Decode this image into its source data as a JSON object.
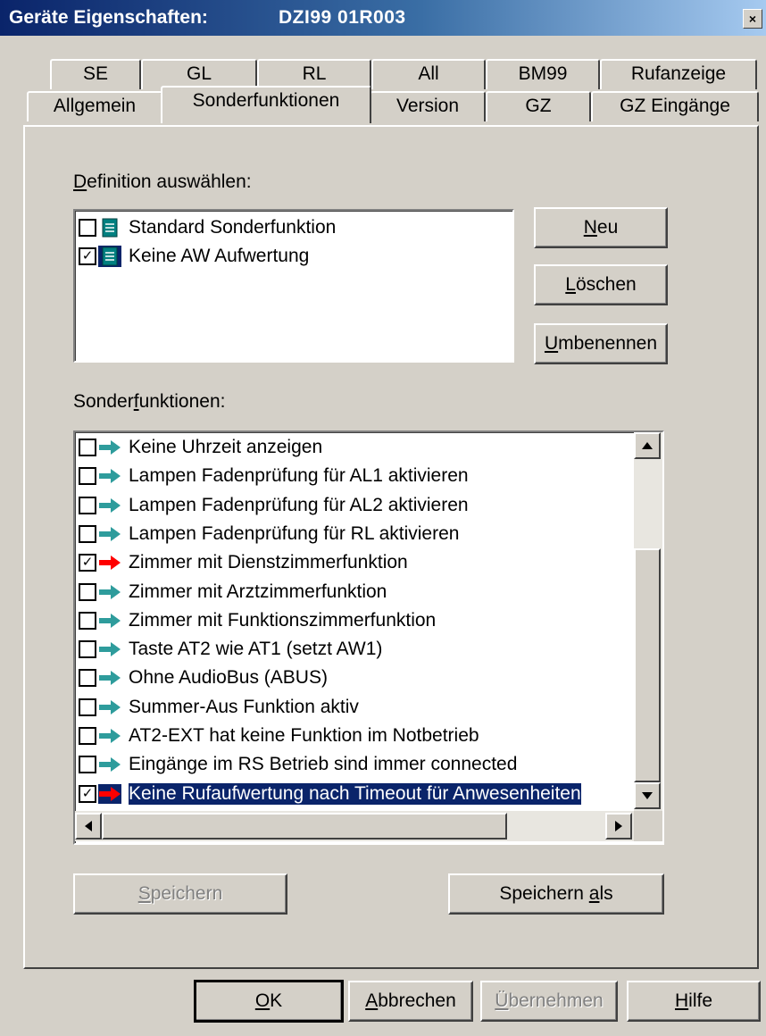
{
  "window": {
    "title_label": "Geräte Eigenschaften:",
    "title_device": "DZI99  01R003",
    "close_glyph": "×"
  },
  "tabs_row1": [
    "SE",
    "GL",
    "RL",
    "All",
    "BM99",
    "Rufanzeige"
  ],
  "tabs_row2": [
    "Allgemein",
    "Sonderfunktionen",
    "Version",
    "GZ",
    "GZ Eingänge"
  ],
  "active_tab": "Sonderfunktionen",
  "definition": {
    "label_mnemonic": "D",
    "label_rest": "efinition auswählen:",
    "items": [
      {
        "label": "Standard Sonderfunktion",
        "checked": false,
        "icon": "document-icon"
      },
      {
        "label": "Keine AW Aufwertung",
        "checked": true,
        "icon": "document-icon"
      }
    ]
  },
  "buttons_side": {
    "neu_mn": "N",
    "neu_rest": "eu",
    "loeschen_mn": "L",
    "loeschen_rest": "öschen",
    "umbenennen_mn": "U",
    "umbenennen_rest": "mbenennen"
  },
  "sonderfunktionen": {
    "label_pre": "Sonder",
    "label_mnemonic": "f",
    "label_post": "unktionen:",
    "items": [
      {
        "label": "Keine Uhrzeit anzeigen",
        "checked": false,
        "arrow": "teal"
      },
      {
        "label": "Lampen Fadenprüfung für AL1 aktivieren",
        "checked": false,
        "arrow": "teal"
      },
      {
        "label": "Lampen Fadenprüfung für AL2 aktivieren",
        "checked": false,
        "arrow": "teal"
      },
      {
        "label": "Lampen Fadenprüfung für RL aktivieren",
        "checked": false,
        "arrow": "teal"
      },
      {
        "label": "Zimmer mit Dienstzimmerfunktion",
        "checked": true,
        "arrow": "red"
      },
      {
        "label": "Zimmer mit Arztzimmerfunktion",
        "checked": false,
        "arrow": "teal"
      },
      {
        "label": "Zimmer mit Funktionszimmerfunktion",
        "checked": false,
        "arrow": "teal"
      },
      {
        "label": "Taste AT2 wie AT1 (setzt AW1)",
        "checked": false,
        "arrow": "teal"
      },
      {
        "label": "Ohne AudioBus (ABUS)",
        "checked": false,
        "arrow": "teal"
      },
      {
        "label": "Summer-Aus Funktion aktiv",
        "checked": false,
        "arrow": "teal"
      },
      {
        "label": "AT2-EXT hat keine Funktion im Notbetrieb",
        "checked": false,
        "arrow": "teal"
      },
      {
        "label": "Eingänge im RS Betrieb sind immer connected",
        "checked": false,
        "arrow": "teal"
      },
      {
        "label": "Keine Rufaufwertung nach Timeout für Anwesenheiten",
        "checked": true,
        "arrow": "red",
        "selected": true
      }
    ]
  },
  "buttons_save": {
    "speichern_mn": "S",
    "speichern_rest": "peichern",
    "speichern_als_pre": "Speichern ",
    "speichern_als_mn": "a",
    "speichern_als_post": "ls"
  },
  "buttons_bottom": {
    "ok_mn": "O",
    "ok_rest": "K",
    "abbrechen_mn": "A",
    "abbrechen_rest": "bbrechen",
    "uebernehmen_mn": "Ü",
    "uebernehmen_rest": "bernehmen",
    "hilfe_mn": "H",
    "hilfe_rest": "ilfe"
  },
  "colors": {
    "arrow_teal": "#2e9c9c",
    "arrow_red": "#ff0000",
    "selection": "#0a246a",
    "doc_icon": "#008080"
  }
}
